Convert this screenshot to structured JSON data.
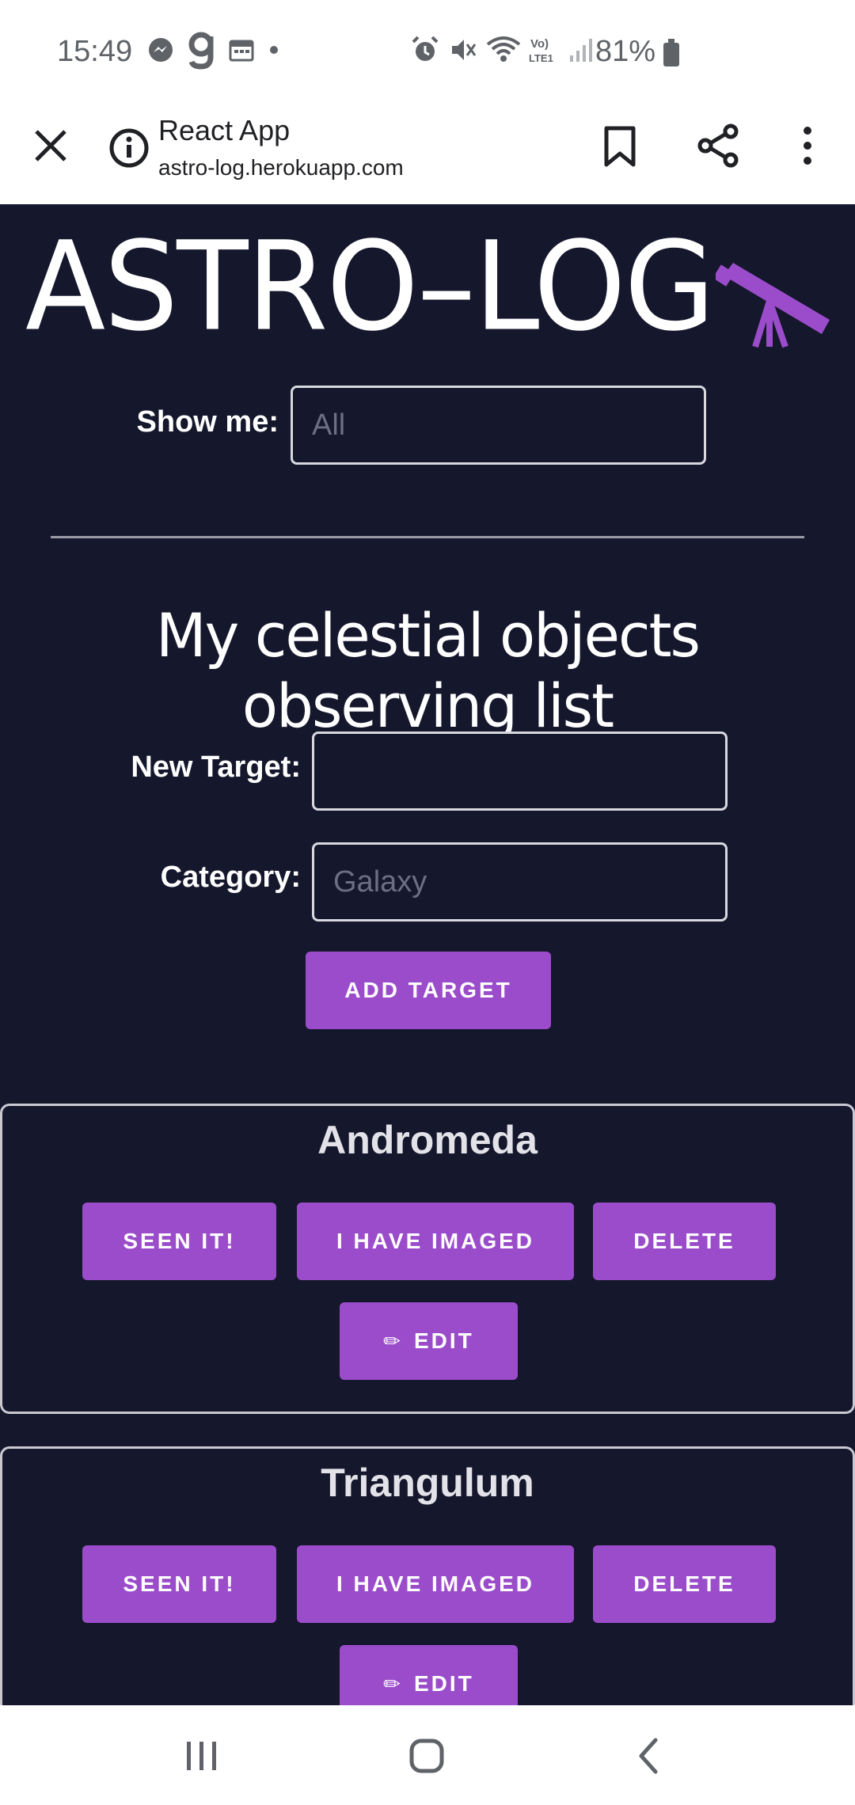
{
  "status_bar": {
    "time": "15:49",
    "battery": "81%",
    "left_icons": [
      "messenger-icon",
      "g-app-icon",
      "calendar-icon",
      "dot-icon"
    ],
    "right_icons": [
      "alarm-icon",
      "mute-icon",
      "wifi-icon",
      "volte-icon",
      "signal-icon",
      "battery-icon"
    ]
  },
  "browser": {
    "title": "React App",
    "url": "astro-log.herokuapp.com"
  },
  "app": {
    "logo_text": "ASTRO–LOG",
    "accent_color": "#9b4ccb",
    "background_color": "#15172c",
    "filter": {
      "label": "Show me:",
      "value": "All"
    },
    "heading": "My celestial objects observing list",
    "form": {
      "target_label": "New Target:",
      "target_value": "",
      "category_label": "Category:",
      "category_value": "Galaxy",
      "add_button": "ADD TARGET"
    },
    "targets": [
      {
        "name": "Andromeda",
        "seen_button": "SEEN IT!",
        "imaged_button": "I HAVE IMAGED",
        "delete_button": "DELETE",
        "edit_button": "EDIT"
      },
      {
        "name": "Triangulum",
        "seen_button": "SEEN IT!",
        "imaged_button": "I HAVE IMAGED",
        "delete_button": "DELETE",
        "edit_button": "EDIT"
      }
    ]
  }
}
